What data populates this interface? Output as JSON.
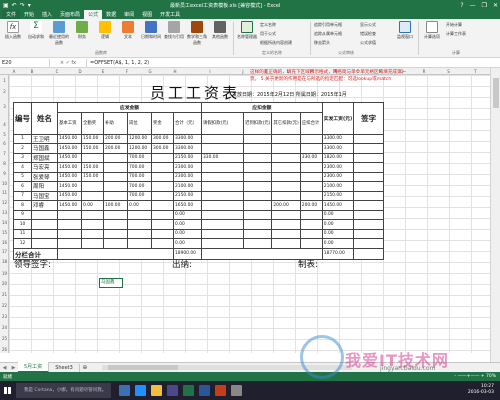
{
  "window": {
    "title": "最新员工excel工资表模板.xls [兼容模式] - Excel",
    "qat": [
      "save",
      "undo",
      "redo",
      "dropdown"
    ],
    "controls": [
      "?",
      "minimize",
      "restore",
      "close"
    ]
  },
  "tabs": [
    "文件",
    "开始",
    "插入",
    "页面布局",
    "公式",
    "数据",
    "审阅",
    "视图",
    "开发工具"
  ],
  "ribbon": {
    "buttons": [
      {
        "label": "插入函数",
        "icon": "fx-icon"
      },
      {
        "label": "自动求和",
        "icon": "sum-icon"
      },
      {
        "label": "最近使用的函数",
        "icon": "book-icon"
      },
      {
        "label": "财务",
        "icon": "finance-icon"
      },
      {
        "label": "逻辑",
        "icon": "logic-icon"
      },
      {
        "label": "文本",
        "icon": "text-icon"
      },
      {
        "label": "日期和时间",
        "icon": "date-icon"
      },
      {
        "label": "查找与引用",
        "icon": "lookup-icon"
      },
      {
        "label": "数学和三角函数",
        "icon": "math-icon"
      },
      {
        "label": "其他函数",
        "icon": "more-icon"
      },
      {
        "label": "名称管理器",
        "icon": "name-manager-icon"
      },
      {
        "label": "监视窗口",
        "icon": "watch-window-icon"
      },
      {
        "label": "计算选项",
        "icon": "calc-options-icon"
      }
    ],
    "defined_names": [
      "定义名称",
      "用于公式",
      "根据所选内容创建"
    ],
    "audit": [
      "追踪引用单元格",
      "追踪从属单元格",
      "移去箭头",
      "显示公式",
      "错误检查",
      "公式求值"
    ],
    "calc_small": [
      "开始计算",
      "计算工作表"
    ],
    "groups": [
      "函数库",
      "定义的名称",
      "公式审核",
      "计算"
    ]
  },
  "formula_bar": {
    "name_box": "E20",
    "icons": "× ✓ fx",
    "formula": "=OFFSET(A$, 1, 1, 2, 2)"
  },
  "columns": [
    "A",
    "B",
    "C",
    "D",
    "E",
    "F",
    "G",
    "H",
    "I",
    "J",
    "K",
    "L",
    "M",
    "N",
    "O",
    "P",
    "Q",
    "R",
    "S",
    "T"
  ],
  "rows": [
    "1",
    "2",
    "3",
    "4",
    "5",
    "6",
    "7",
    "8",
    "9",
    "10",
    "11",
    "12",
    "13",
    "14",
    "15",
    "16",
    "17",
    "18",
    "19",
    "20",
    "21",
    "22",
    "23",
    "24",
    "25",
    "26"
  ],
  "sheet": {
    "title": "员工工资表",
    "issue_info": "发放日期：2015年2月12日 所属日期：2015年1月",
    "note": "这样的是正确的，填充下区域所示格式，网络简与单个单元格区域填充成第一页。 5.关于更新的作用是在与所选的指定匹配：可选lookup或match",
    "headers": {
      "number": "编号",
      "name": "姓名",
      "should_pay": "应发金额",
      "deduction": "应扣金额",
      "actual": "实发工资(元)",
      "signature": "签字"
    },
    "subheaders": [
      "基本工资",
      "全勤奖",
      "补助",
      "岗位",
      "奖金",
      "合计（元）",
      "请假扣款(元)",
      "迟到扣款(元)",
      "其它扣款(元)",
      "应扣合计"
    ],
    "employees": [
      {
        "no": "1",
        "name": "王卫明",
        "cells": [
          "1450.00",
          "150.00",
          "200.00",
          "1200.00",
          "300.00",
          "3300.00",
          "",
          "",
          "",
          "",
          "3300.00"
        ]
      },
      {
        "no": "2",
        "name": "马国鑫",
        "cells": [
          "1450.00",
          "150.00",
          "200.00",
          "1200.00",
          "300.00",
          "3300.00",
          "",
          "",
          "",
          "",
          "3300.00"
        ]
      },
      {
        "no": "3",
        "name": "郑国斌",
        "cells": [
          "1450.00",
          "",
          "",
          "700.00",
          "",
          "2150.00",
          "330.00",
          "",
          "",
          "330.00",
          "1820.00"
        ]
      },
      {
        "no": "4",
        "name": "马宏亮",
        "cells": [
          "1450.00",
          "150.00",
          "",
          "700.00",
          "",
          "2300.00",
          "",
          "",
          "",
          "",
          "2300.00"
        ]
      },
      {
        "no": "5",
        "name": "张爱琴",
        "cells": [
          "1450.00",
          "150.00",
          "",
          "700.00",
          "",
          "2300.00",
          "",
          "",
          "",
          "",
          "2300.00"
        ]
      },
      {
        "no": "6",
        "name": "周阳",
        "cells": [
          "1450.00",
          "",
          "",
          "700.00",
          "",
          "2100.00",
          "",
          "",
          "",
          "",
          "2100.00"
        ]
      },
      {
        "no": "7",
        "name": "马国宝",
        "cells": [
          "1450.00",
          "",
          "",
          "700.00",
          "",
          "2150.00",
          "",
          "",
          "",
          "",
          "2150.00"
        ]
      },
      {
        "no": "8",
        "name": "邓睿",
        "cells": [
          "1450.00",
          "0.00",
          "100.00",
          "0.00",
          "",
          "1650.00",
          "",
          "",
          "200.00",
          "200.00",
          "1450.00"
        ]
      },
      {
        "no": "9",
        "name": "",
        "cells": [
          "",
          "",
          "",
          "",
          "",
          "0.00",
          "",
          "",
          "",
          "",
          "0.00"
        ]
      },
      {
        "no": "10",
        "name": "",
        "cells": [
          "",
          "",
          "",
          "",
          "",
          "0.00",
          "",
          "",
          "",
          "",
          "0.00"
        ]
      },
      {
        "no": "11",
        "name": "",
        "cells": [
          "",
          "",
          "",
          "",
          "",
          "0.00",
          "",
          "",
          "",
          "",
          "0.00"
        ]
      },
      {
        "no": "12",
        "name": "",
        "cells": [
          "",
          "",
          "",
          "",
          "",
          "0.00",
          "",
          "",
          "",
          "",
          "0.00"
        ]
      }
    ],
    "total_label": "分栏合计",
    "total_sum": "18900.00",
    "total_actual": "18770.00",
    "signatures": [
      "领导签字:",
      "出纳:",
      "制表:"
    ],
    "selected_cell_text": "马国鑫"
  },
  "sheet_tabs": [
    "5月工资",
    "Sheet3"
  ],
  "status": {
    "left": "就绪",
    "zoom": "- ——+—— + 70%"
  },
  "taskbar": {
    "search": "我是 Cortana，小娜。有问题尽管问我。",
    "time": "10:27",
    "date": "2016-03-03"
  },
  "watermark": {
    "main": "我爱IT技术网",
    "url": "jingyan.baidu.com"
  },
  "colors": {
    "excel_green": "#217346",
    "note_red": "#e02020",
    "watermark_pink": "#d64094"
  }
}
